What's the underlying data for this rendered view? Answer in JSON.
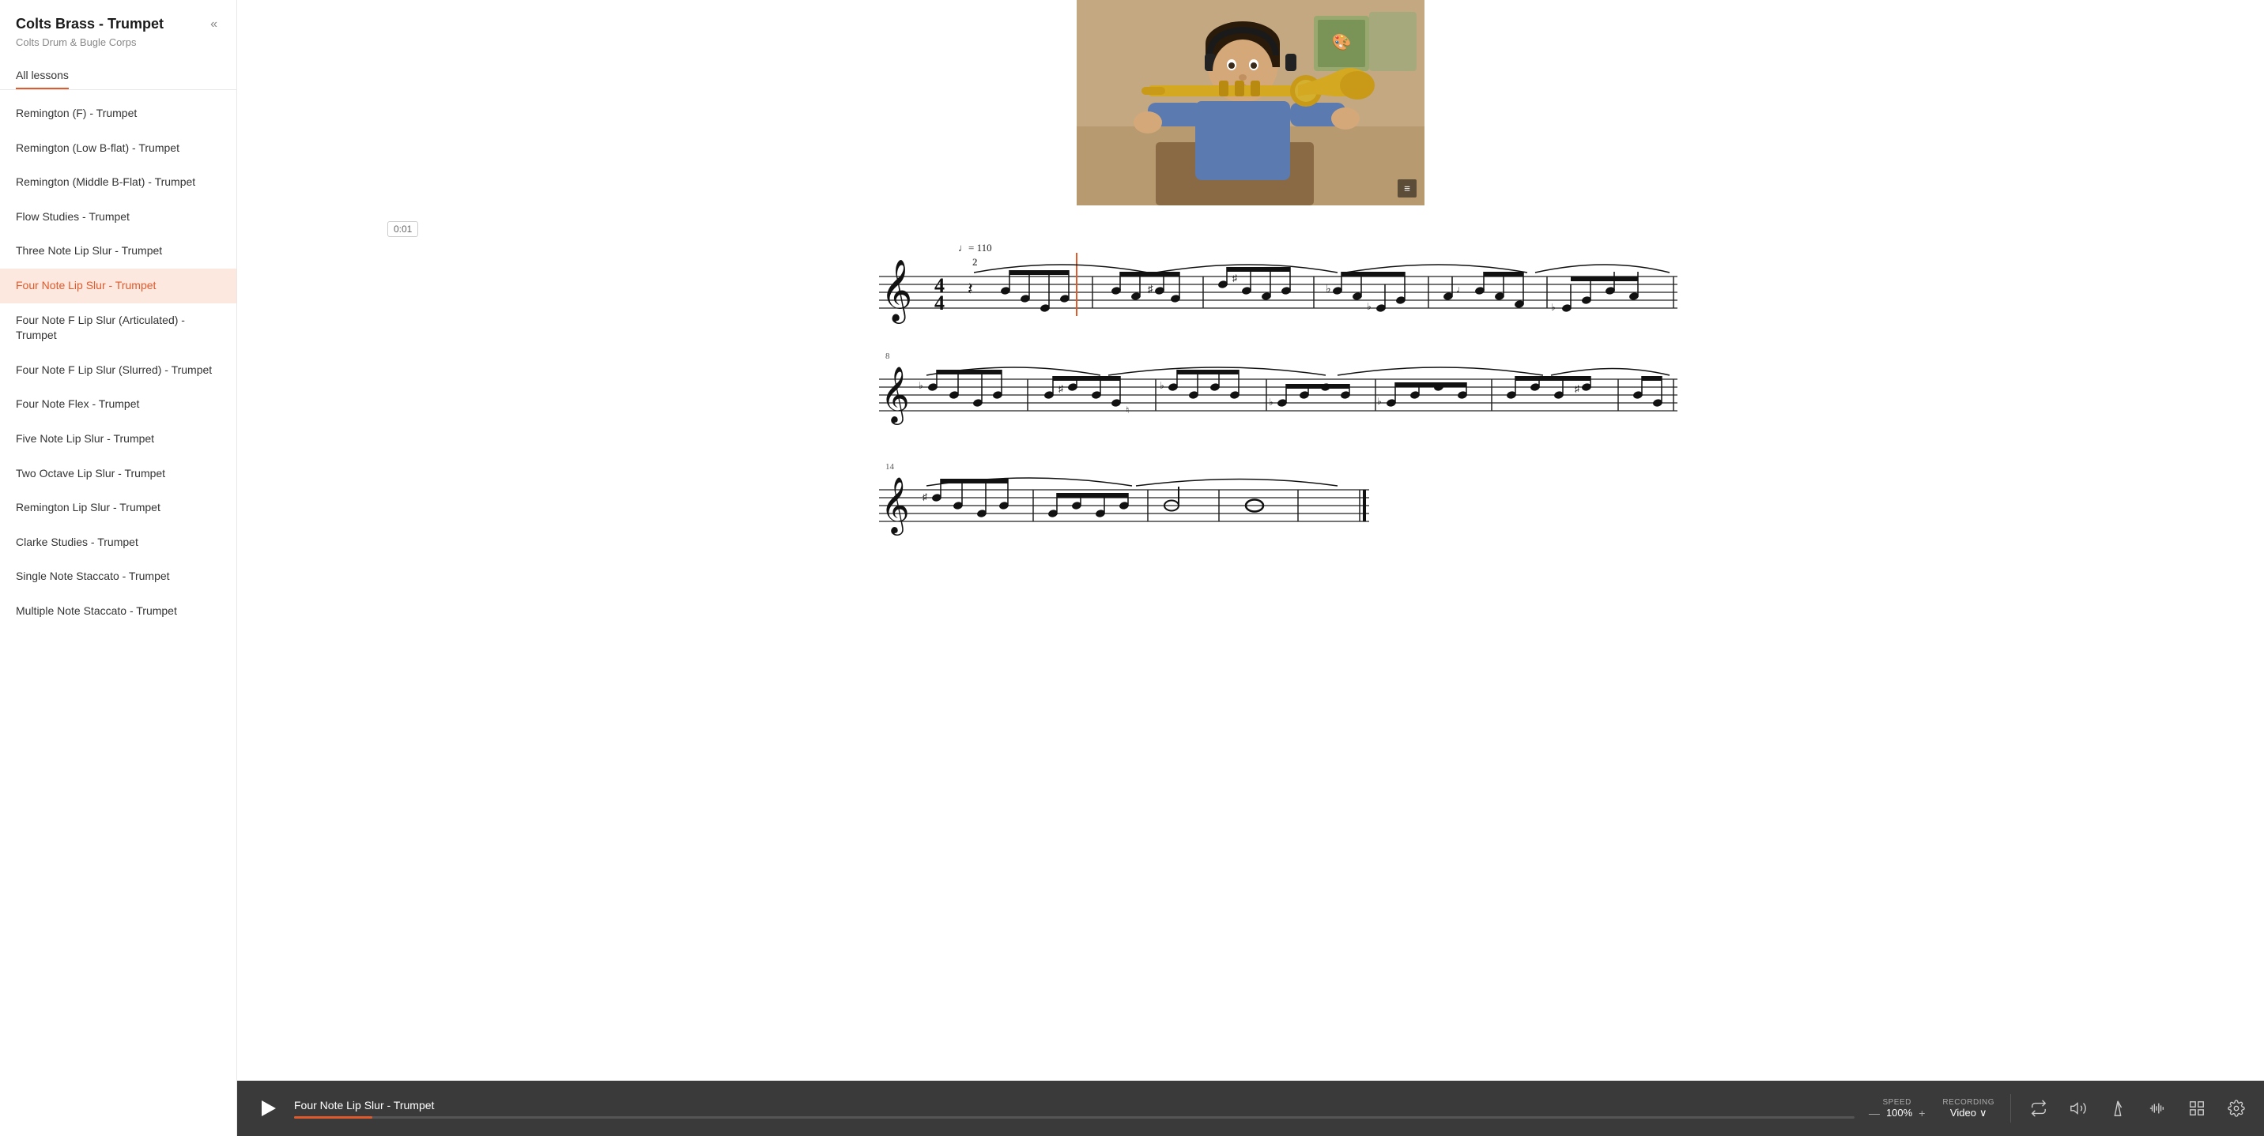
{
  "sidebar": {
    "title": "Colts Brass - Trumpet",
    "subtitle": "Colts Drum & Bugle Corps",
    "collapse_label": "«",
    "all_lessons_label": "All lessons",
    "lessons": [
      {
        "id": "remington-f",
        "label": "Remington (F) - Trumpet",
        "active": false
      },
      {
        "id": "remington-low-bb",
        "label": "Remington (Low B-flat) - Trumpet",
        "active": false
      },
      {
        "id": "remington-middle-bf",
        "label": "Remington (Middle B-Flat) - Trumpet",
        "active": false
      },
      {
        "id": "flow-studies",
        "label": "Flow Studies - Trumpet",
        "active": false
      },
      {
        "id": "three-note-lip-slur",
        "label": "Three Note Lip Slur - Trumpet",
        "active": false
      },
      {
        "id": "four-note-lip-slur",
        "label": "Four Note Lip Slur - Trumpet",
        "active": true
      },
      {
        "id": "four-note-f-articulated",
        "label": "Four Note F Lip Slur (Articulated) - Trumpet",
        "active": false
      },
      {
        "id": "four-note-f-slurred",
        "label": "Four Note F Lip Slur (Slurred) - Trumpet",
        "active": false
      },
      {
        "id": "four-note-flex",
        "label": "Four Note Flex - Trumpet",
        "active": false
      },
      {
        "id": "five-note-lip-slur",
        "label": "Five Note Lip Slur - Trumpet",
        "active": false
      },
      {
        "id": "two-octave-lip-slur",
        "label": "Two Octave Lip Slur - Trumpet",
        "active": false
      },
      {
        "id": "remington-lip-slur",
        "label": "Remington Lip Slur - Trumpet",
        "active": false
      },
      {
        "id": "clarke-studies",
        "label": "Clarke Studies - Trumpet",
        "active": false
      },
      {
        "id": "single-note-staccato",
        "label": "Single Note Staccato - Trumpet",
        "active": false
      },
      {
        "id": "multiple-note-staccato",
        "label": "Multiple Note Staccato - Trumpet",
        "active": false
      }
    ]
  },
  "video": {
    "menu_icon": "≡"
  },
  "sheet_music": {
    "time_indicator": "0:01",
    "tempo": "♩= 110",
    "measure_numbers": [
      "2",
      "8",
      "14"
    ]
  },
  "player": {
    "title": "Four Note Lip Slur - Trumpet",
    "progress_percent": 5,
    "speed_label": "SPEED",
    "speed_minus": "—",
    "speed_value": "100%",
    "speed_plus": "+",
    "recording_label": "RECORDING",
    "recording_value": "Video",
    "recording_chevron": "∨",
    "icons": {
      "loop": "loop",
      "volume": "volume",
      "metronome": "metronome",
      "waveform": "waveform",
      "grid": "grid",
      "settings": "settings"
    }
  }
}
